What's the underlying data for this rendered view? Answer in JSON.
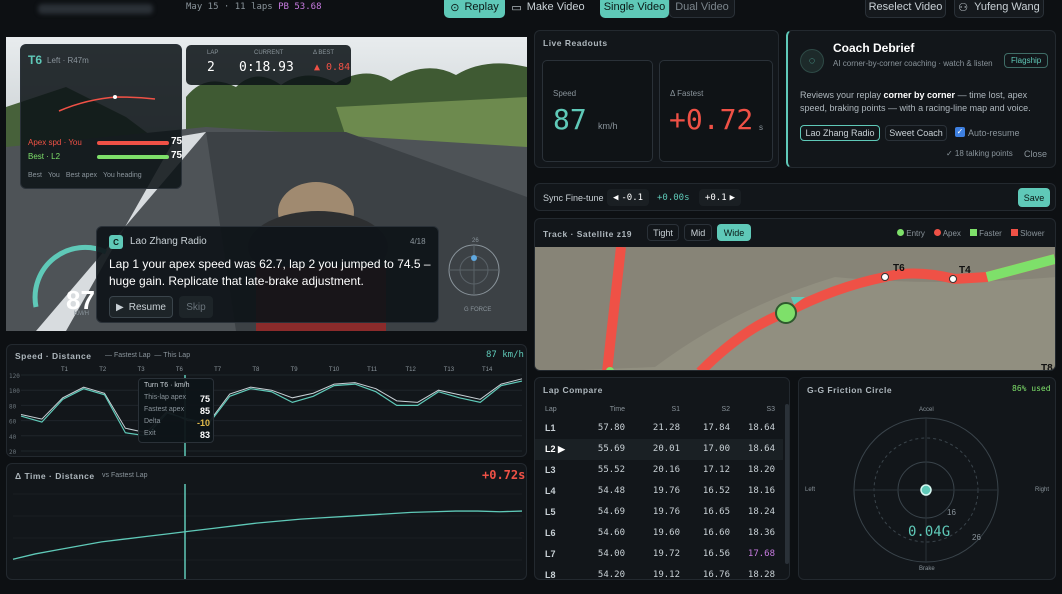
{
  "topbar": {
    "session_info": "May 15 · 11 laps",
    "pb_label": "PB",
    "pb_value": "53.68",
    "replay": "Replay",
    "make_video": "Make Video",
    "single_video": "Single Video",
    "dual_video": "Dual Video",
    "reselect": "Reselect Video",
    "user": "Yufeng Wang"
  },
  "video": {
    "corner": "T6",
    "corner_side": "Left · R47m",
    "apex_label": "Apex spd",
    "you": "You",
    "apex_you": "75",
    "best_label": "Best",
    "best_lap": "L2",
    "best_value": "75",
    "legend": [
      "Best",
      "You",
      "Best apex",
      "You heading"
    ],
    "lap_label": "LAP",
    "lap_value": "2",
    "current_label": "CURRENT",
    "current_value": "0:18.93",
    "best_delta_label": "Δ BEST",
    "best_delta": "▲ 0.84",
    "speed_value": "87",
    "speed_unit": "KM/H",
    "gforce": "G FORCE",
    "gforce_scale": "26"
  },
  "coach_bubble": {
    "avatar": "C",
    "name": "Lao Zhang Radio",
    "counter": "4/18",
    "message": "Lap 1 your apex speed was 62.7, lap 2 you jumped to 74.5 – huge gain. Replicate that late-brake adjustment.",
    "resume": "Resume",
    "skip": "Skip"
  },
  "readouts": {
    "title": "Live Readouts",
    "speed_label": "Speed",
    "speed_value": "87",
    "speed_unit": "km/h",
    "fastest_label": "Δ Fastest",
    "fastest_value": "+0.72",
    "fastest_unit": "s"
  },
  "debrief": {
    "title": "Coach Debrief",
    "badge": "Flagship",
    "subtitle": "AI corner-by-corner coaching · watch & listen",
    "desc_pre": "Reviews your replay ",
    "desc_bold": "corner by corner",
    "desc_post": " — time lost, apex speed, braking points — with a racing-line map and voice.",
    "voice1": "Lao Zhang Radio",
    "voice2": "Sweet Coach",
    "auto_resume": "Auto-resume",
    "talking": "✓ 18 talking points",
    "close": "Close"
  },
  "sync": {
    "label": "Sync Fine-tune",
    "minus": "-0.1",
    "value": "+0.00s",
    "plus": "+0.1",
    "save": "Save"
  },
  "track": {
    "title": "Track · Satellite z19",
    "zoom": [
      "Tight",
      "Mid",
      "Wide"
    ],
    "legend": [
      {
        "label": "Entry",
        "color": "#7ee06a"
      },
      {
        "label": "Apex",
        "color": "#ef5146"
      },
      {
        "label": "Faster",
        "color": "#7ee06a"
      },
      {
        "label": "Slower",
        "color": "#ef5146"
      }
    ],
    "markers": [
      "T6",
      "T4",
      "T8"
    ]
  },
  "speed_chart": {
    "title": "Speed · Distance",
    "legend_fast": "Fastest Lap",
    "legend_this": "This Lap",
    "readout": "87 km/h",
    "turns": [
      "T1",
      "T2",
      "T3",
      "T6",
      "T7",
      "T8",
      "T9",
      "T10",
      "T11",
      "T12",
      "T13",
      "T14"
    ],
    "yticks": [
      "120",
      "100",
      "80",
      "60",
      "40",
      "20"
    ],
    "tooltip": {
      "title": "Turn T6 · km/h",
      "rows": [
        {
          "k": "This-lap apex",
          "v": "75"
        },
        {
          "k": "Fastest apex",
          "v": "85"
        },
        {
          "k": "Delta",
          "v": "-10"
        },
        {
          "k": "Exit",
          "v": "83"
        }
      ]
    }
  },
  "chart_data": [
    {
      "type": "line",
      "title": "Speed · Distance",
      "ylim": [
        20,
        120
      ],
      "series": [
        {
          "name": "Fastest Lap",
          "values": [
            68,
            62,
            90,
            104,
            96,
            50,
            44,
            72,
            60,
            58,
            95,
            104,
            100,
            90,
            96,
            108,
            110,
            102,
            86,
            84,
            100,
            94,
            88,
            108,
            115
          ]
        },
        {
          "name": "This Lap",
          "values": [
            66,
            58,
            88,
            102,
            94,
            44,
            40,
            70,
            62,
            56,
            92,
            102,
            98,
            84,
            92,
            106,
            108,
            98,
            80,
            80,
            98,
            90,
            84,
            106,
            112
          ]
        }
      ]
    },
    {
      "type": "line",
      "title": "Time · Distance",
      "series": [
        {
          "name": "vs Fastest Lap",
          "values": [
            0.0,
            0.08,
            0.14,
            0.2,
            0.26,
            0.3,
            0.34,
            0.38,
            0.42,
            0.46,
            0.5,
            0.54,
            0.57,
            0.6,
            0.62,
            0.64,
            0.66,
            0.68,
            0.7,
            0.71,
            0.72,
            0.72,
            0.71,
            0.72
          ]
        }
      ]
    }
  ],
  "time_chart": {
    "title": "Δ Time · Distance",
    "legend": "vs Fastest Lap",
    "value": "+0.72s"
  },
  "lap_compare": {
    "title": "Lap Compare",
    "headers": [
      "Lap",
      "Time",
      "S1",
      "S2",
      "S3"
    ],
    "rows": [
      [
        "L1",
        "57.80",
        "21.28",
        "17.84",
        "18.64"
      ],
      [
        "L2",
        "55.69",
        "20.01",
        "17.00",
        "18.64"
      ],
      [
        "L3",
        "55.52",
        "20.16",
        "17.12",
        "18.20"
      ],
      [
        "L4",
        "54.48",
        "19.76",
        "16.52",
        "18.16"
      ],
      [
        "L5",
        "54.69",
        "19.76",
        "16.65",
        "18.24"
      ],
      [
        "L6",
        "54.60",
        "19.60",
        "16.60",
        "18.36"
      ],
      [
        "L7",
        "54.00",
        "19.72",
        "16.56",
        "17.68"
      ],
      [
        "L8",
        "54.20",
        "19.12",
        "16.76",
        "18.28"
      ]
    ]
  },
  "gg": {
    "title": "G-G Friction Circle",
    "used": "86% used",
    "accel": "Accel",
    "brake": "Brake",
    "left": "Left",
    "right": "Right",
    "r1": "16",
    "r2": "26",
    "value": "0.04G"
  }
}
